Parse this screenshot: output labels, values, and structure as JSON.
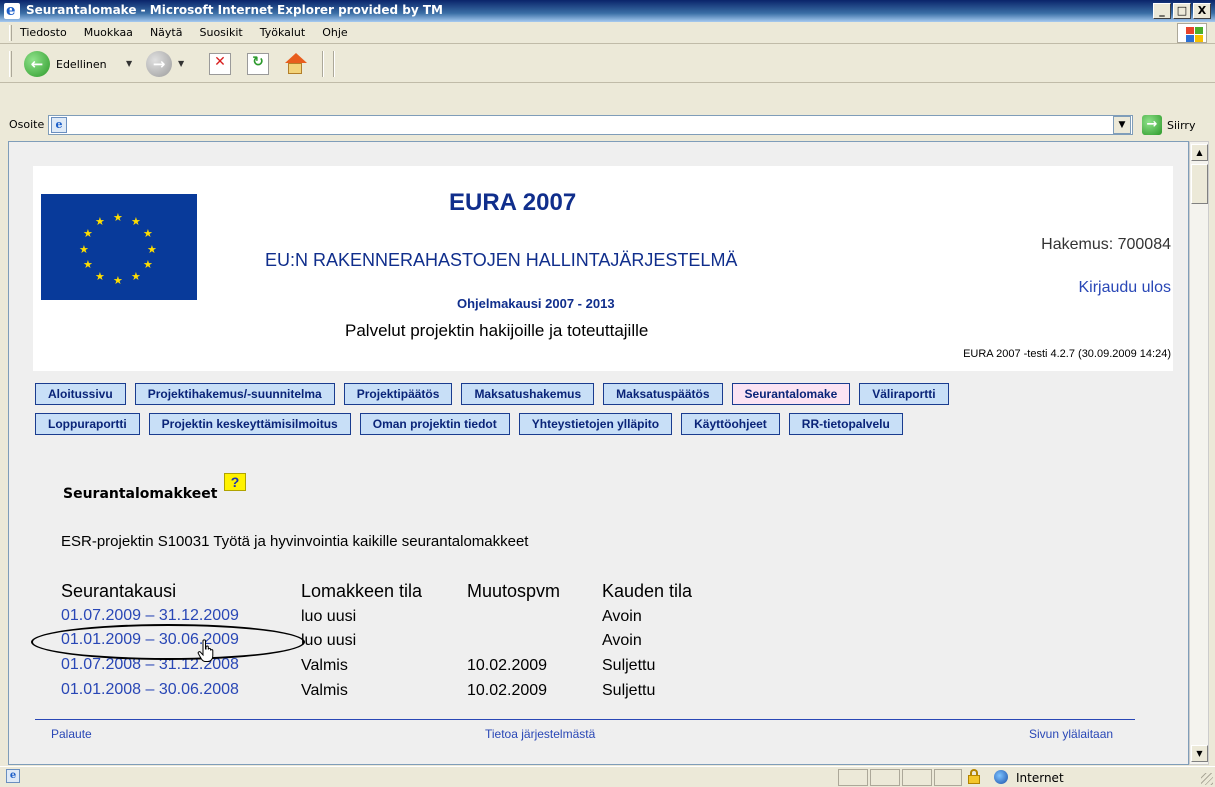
{
  "window": {
    "title": "Seurantalomake - Microsoft Internet Explorer provided by TM",
    "buttons": {
      "minimize": "_",
      "maximize": "□",
      "close": "X"
    }
  },
  "menubar": {
    "items": [
      "Tiedosto",
      "Muokkaa",
      "Näytä",
      "Suosikit",
      "Työkalut",
      "Ohje"
    ]
  },
  "toolbar": {
    "back_label": "Edellinen"
  },
  "address": {
    "label": "Osoite",
    "value": "",
    "go_label": "Siirry"
  },
  "header": {
    "title": "EURA 2007",
    "subtitle": "EU:N RAKENNERAHASTOJEN HALLINTAJÄRJESTELMÄ",
    "program_period": "Ohjelmakausi 2007 - 2013",
    "services": "Palvelut projektin hakijoille ja toteuttajille",
    "application_number": "Hakemus: 700084",
    "logout": "Kirjaudu ulos",
    "version": "EURA 2007 -testi 4.2.7 (30.09.2009 14:24)"
  },
  "nav": {
    "row1": [
      "Aloitussivu",
      "Projektihakemus/-suunnitelma",
      "Projektipäätös",
      "Maksatushakemus",
      "Maksatuspäätös",
      "Seurantalomake",
      "Väliraportti"
    ],
    "row2": [
      "Loppuraportti",
      "Projektin keskeyttämisilmoitus",
      "Oman projektin tiedot",
      "Yhteystietojen ylläpito",
      "Käyttöohjeet",
      "RR-tietopalvelu"
    ],
    "active": "Seurantalomake"
  },
  "content": {
    "title": "Seurantalomakkeet",
    "help_label": "?",
    "description": "ESR-projektin S10031 Työtä ja hyvinvointia kaikille seurantalomakkeet"
  },
  "table": {
    "headers": [
      "Seurantakausi",
      "Lomakkeen tila",
      "Muutospvm",
      "Kauden tila"
    ],
    "rows": [
      {
        "period": "01.07.2009 – 31.12.2009",
        "form_status": "luo uusi",
        "changed": "",
        "period_status": "Avoin"
      },
      {
        "period": "01.01.2009 – 30.06.2009",
        "form_status": "luo uusi",
        "changed": "",
        "period_status": "Avoin"
      },
      {
        "period": "01.07.2008 – 31.12.2008",
        "form_status": "Valmis",
        "changed": "10.02.2009",
        "period_status": "Suljettu"
      },
      {
        "period": "01.01.2008 – 30.06.2008",
        "form_status": "Valmis",
        "changed": "10.02.2009",
        "period_status": "Suljettu"
      }
    ]
  },
  "footer": {
    "feedback": "Palaute",
    "about": "Tietoa järjestelmästä",
    "top": "Sivun ylälaitaan"
  },
  "statusbar": {
    "zone": "Internet"
  },
  "colors": {
    "link": "#2947b6",
    "heading": "#102e8c",
    "nav_bg": "#c8dff7",
    "nav_active_bg": "#fbe3f3",
    "eu_blue": "#083a9a",
    "help_yellow": "#fff200"
  },
  "icons": [
    "ie-icon",
    "windows-logo-icon",
    "back-icon",
    "forward-icon",
    "stop-icon",
    "refresh-icon",
    "home-icon",
    "page-icon",
    "go-icon",
    "help-icon",
    "hand-cursor-icon",
    "lock-icon",
    "globe-icon"
  ]
}
